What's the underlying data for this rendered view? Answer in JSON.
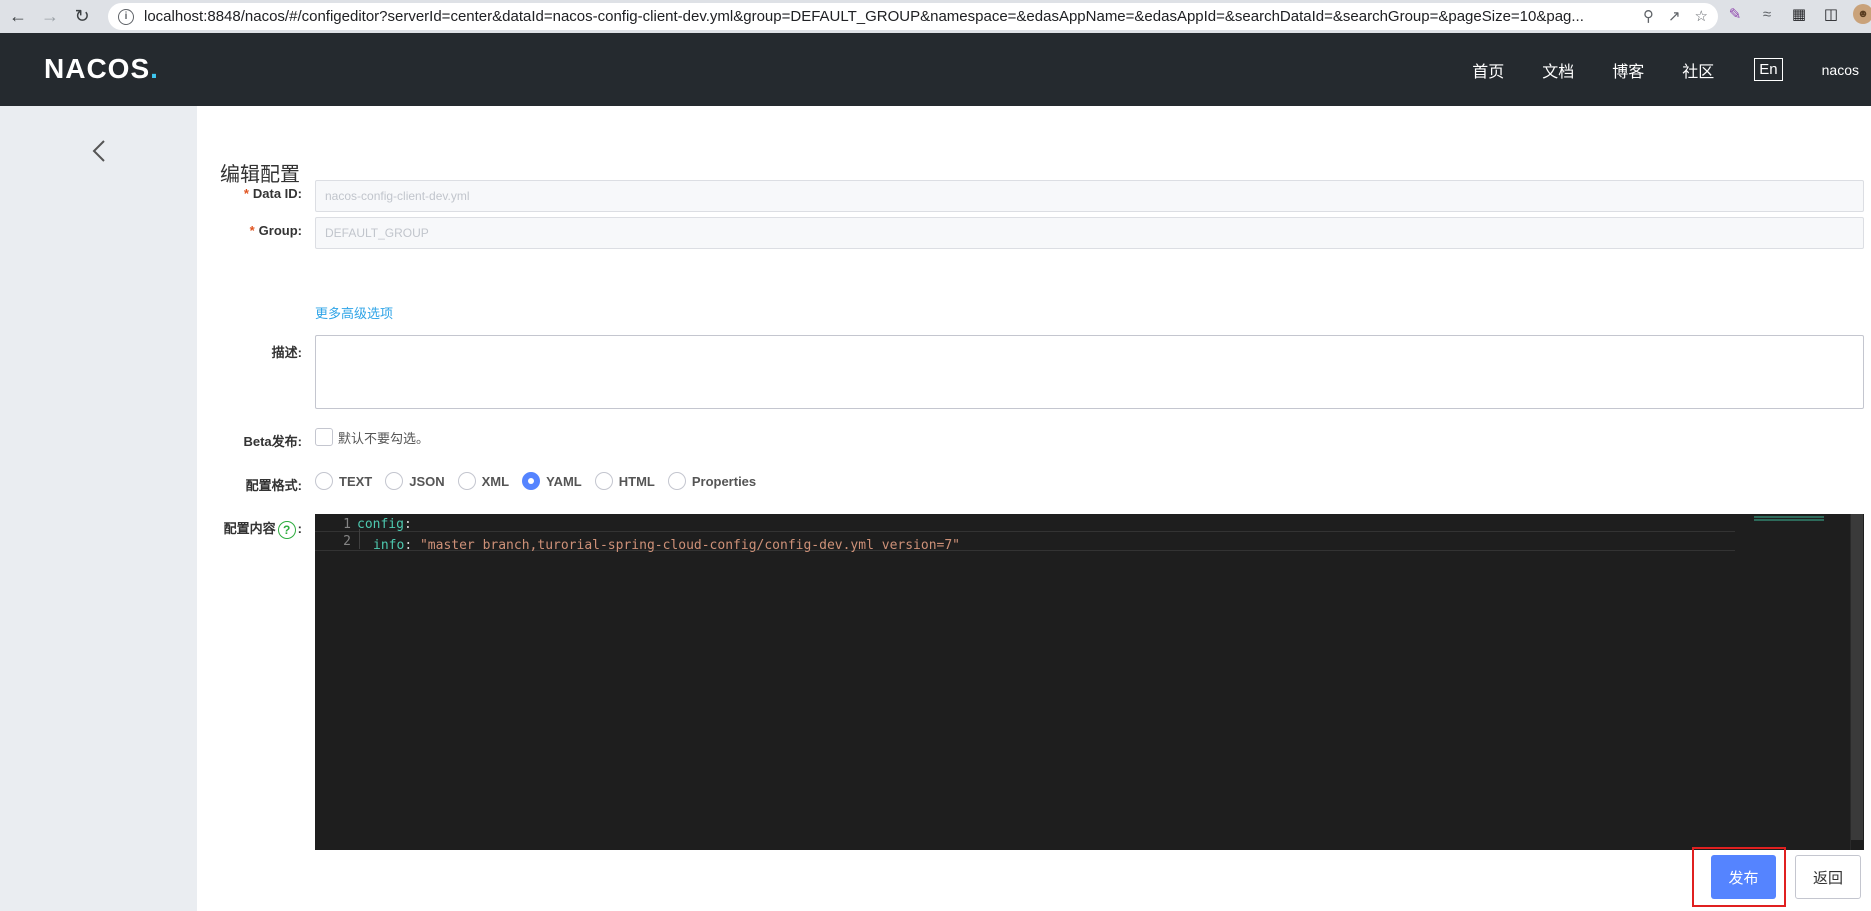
{
  "browser": {
    "url": "localhost:8848/nacos/#/configeditor?serverId=center&dataId=nacos-config-client-dev.yml&group=DEFAULT_GROUP&namespace=&edasAppName=&edasAppId=&searchDataId=&searchGroup=&pageSize=10&pag..."
  },
  "header": {
    "logo": "NACOS",
    "nav": [
      "首页",
      "文档",
      "博客",
      "社区"
    ],
    "lang": "En",
    "user": "nacos"
  },
  "form": {
    "title": "编辑配置",
    "data_id_label": "Data ID:",
    "data_id_value": "nacos-config-client-dev.yml",
    "group_label": "Group:",
    "group_value": "DEFAULT_GROUP",
    "advanced_link": "更多高级选项",
    "desc_label": "描述:",
    "beta_label": "Beta发布:",
    "beta_checkbox_text": "默认不要勾选。",
    "format_label": "配置格式:",
    "format_options": [
      "TEXT",
      "JSON",
      "XML",
      "YAML",
      "HTML",
      "Properties"
    ],
    "format_selected": "YAML",
    "content_label": "配置内容",
    "content_colon": ":",
    "help_glyph": "?"
  },
  "editor": {
    "lines": [
      {
        "num": "1",
        "key": "config",
        "punc": ":",
        "value": ""
      },
      {
        "num": "2",
        "key": "info",
        "punc": ": ",
        "value": "\"master branch,turorial-spring-cloud-config/config-dev.yml version=7\""
      }
    ]
  },
  "actions": {
    "publish": "发布",
    "back": "返回"
  },
  "colors": {
    "header_bg": "#252a2f",
    "primary": "#5584ff",
    "link": "#2fa4e7",
    "highlight": "#e02020"
  }
}
